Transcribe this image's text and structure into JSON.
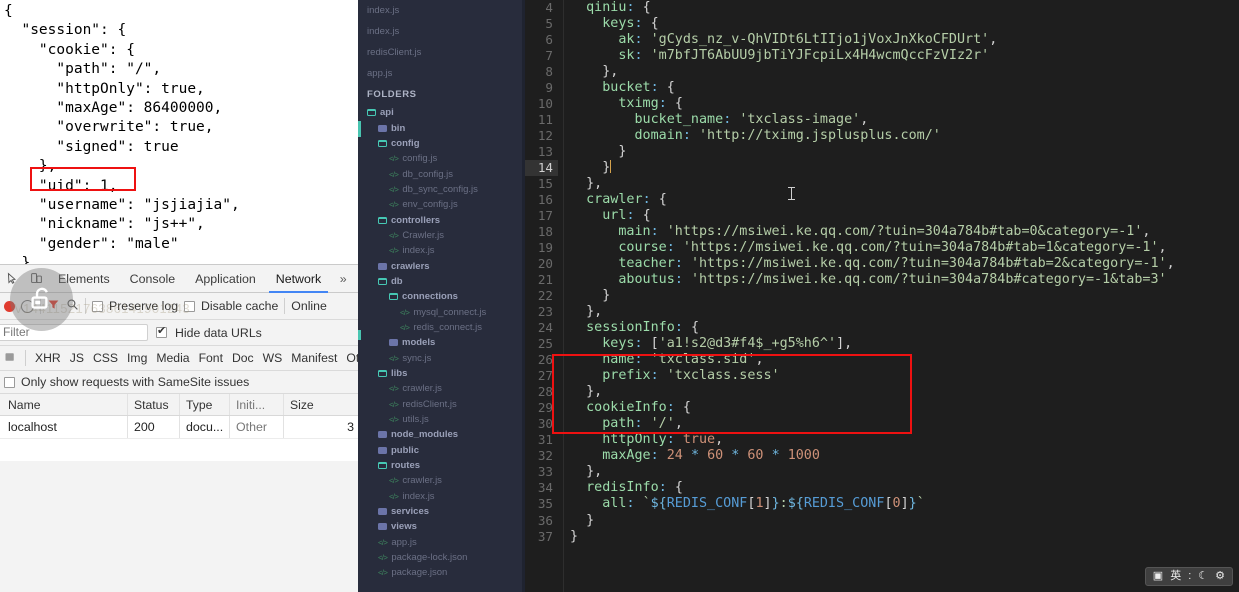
{
  "browser": {
    "json_response": [
      "{",
      "  \"session\": {",
      "    \"cookie\": {",
      "      \"path\": \"/\",",
      "      \"httpOnly\": true,",
      "      \"maxAge\": 86400000,",
      "      \"overwrite\": true,",
      "      \"signed\": true",
      "    },",
      "    \"uid\": 1,",
      "    \"username\": \"jsjiajia\",",
      "    \"nickname\": \"js++\",",
      "    \"gender\": \"male\"",
      "  }"
    ],
    "highlight_note": "uid-highlight"
  },
  "devtools": {
    "tabs": [
      {
        "label": "Elements",
        "active": false
      },
      {
        "label": "Console",
        "active": false
      },
      {
        "label": "Application",
        "active": false
      },
      {
        "label": "Network",
        "active": true
      }
    ],
    "toolbar": {
      "preserve_log_label": "Preserve log",
      "preserve_log_checked": false,
      "disable_cache_label": "Disable cache",
      "disable_cache_checked": false,
      "online_label": "Online"
    },
    "filter": {
      "placeholder": "Filter",
      "value": "",
      "hide_data_urls_label": "Hide data URLs",
      "hide_data_urls_checked": true
    },
    "types": [
      "XHR",
      "JS",
      "CSS",
      "Img",
      "Media",
      "Font",
      "Doc",
      "WS",
      "Manifest",
      "Other"
    ],
    "samesite": {
      "label": "Only show requests with SameSite issues",
      "checked": false
    },
    "table": {
      "columns": [
        "Name",
        "Status",
        "Type",
        "Initi...",
        "Size"
      ],
      "rows": [
        {
          "name": "localhost",
          "status": "200",
          "type": "docu...",
          "initiator": "Other",
          "size": "3"
        }
      ]
    },
    "watermark_text": "V1441152176386141901243"
  },
  "sidebar": {
    "open_files": [
      "index.js",
      "index.js",
      "redisClient.js",
      "app.js"
    ],
    "folders_label": "FOLDERS",
    "tree": [
      {
        "label": "api",
        "icon": "folder-open",
        "indent": 0
      },
      {
        "label": "bin",
        "icon": "folder-solid",
        "indent": 1
      },
      {
        "label": "config",
        "icon": "folder-open",
        "indent": 1
      },
      {
        "label": "config.js",
        "icon": "file",
        "indent": 2
      },
      {
        "label": "db_config.js",
        "icon": "file",
        "indent": 2
      },
      {
        "label": "db_sync_config.js",
        "icon": "file",
        "indent": 2
      },
      {
        "label": "env_config.js",
        "icon": "file",
        "indent": 2
      },
      {
        "label": "controllers",
        "icon": "folder-open",
        "indent": 1
      },
      {
        "label": "Crawler.js",
        "icon": "file",
        "indent": 2
      },
      {
        "label": "index.js",
        "icon": "file",
        "indent": 2
      },
      {
        "label": "crawlers",
        "icon": "folder-solid",
        "indent": 1
      },
      {
        "label": "db",
        "icon": "folder-open",
        "indent": 1
      },
      {
        "label": "connections",
        "icon": "folder-open",
        "indent": 2
      },
      {
        "label": "mysql_connect.js",
        "icon": "file",
        "indent": 3
      },
      {
        "label": "redis_connect.js",
        "icon": "file",
        "indent": 3
      },
      {
        "label": "models",
        "icon": "folder-solid",
        "indent": 2
      },
      {
        "label": "sync.js",
        "icon": "file",
        "indent": 2
      },
      {
        "label": "libs",
        "icon": "folder-open",
        "indent": 1
      },
      {
        "label": "crawler.js",
        "icon": "file",
        "indent": 2
      },
      {
        "label": "redisClient.js",
        "icon": "file",
        "indent": 2
      },
      {
        "label": "utils.js",
        "icon": "file",
        "indent": 2
      },
      {
        "label": "node_modules",
        "icon": "folder-solid",
        "indent": 1
      },
      {
        "label": "public",
        "icon": "folder-solid",
        "indent": 1
      },
      {
        "label": "routes",
        "icon": "folder-open",
        "indent": 1
      },
      {
        "label": "crawler.js",
        "icon": "file",
        "indent": 2
      },
      {
        "label": "index.js",
        "icon": "file",
        "indent": 2
      },
      {
        "label": "services",
        "icon": "folder-solid",
        "indent": 1
      },
      {
        "label": "views",
        "icon": "folder-solid",
        "indent": 1
      },
      {
        "label": "app.js",
        "icon": "file",
        "indent": 1
      },
      {
        "label": "package-lock.json",
        "icon": "file",
        "indent": 1
      },
      {
        "label": "package.json",
        "icon": "file",
        "indent": 1
      }
    ]
  },
  "editor": {
    "first_line_number": 4,
    "current_line": 14,
    "lines": [
      {
        "n": 4,
        "html": "  <span class='k'>qiniu</span><span class='p'>:</span> <span class='w'>{</span>"
      },
      {
        "n": 5,
        "html": "    <span class='k'>keys</span><span class='p'>:</span> <span class='w'>{</span>"
      },
      {
        "n": 6,
        "html": "      <span class='k'>ak</span><span class='p'>:</span> <span class='s'>'gCyds_nz_v-QhVIDt6LtIIjo1jVoxJnXkoCFDUrt'</span><span class='w'>,</span>"
      },
      {
        "n": 7,
        "html": "      <span class='k'>sk</span><span class='p'>:</span> <span class='s'>'m7bfJT6AbUU9jbTiYJFcpiLx4H4wcmQccFzVIz2r'</span>"
      },
      {
        "n": 8,
        "html": "    <span class='w'>},</span>"
      },
      {
        "n": 9,
        "html": "    <span class='k'>bucket</span><span class='p'>:</span> <span class='w'>{</span>"
      },
      {
        "n": 10,
        "html": "      <span class='k'>tximg</span><span class='p'>:</span> <span class='w'>{</span>"
      },
      {
        "n": 11,
        "html": "        <span class='k'>bucket_name</span><span class='p'>:</span> <span class='s'>'txclass-image'</span><span class='w'>,</span>"
      },
      {
        "n": 12,
        "html": "        <span class='k'>domain</span><span class='p'>:</span> <span class='s'>'http://tximg.jsplusplus.com/'</span>"
      },
      {
        "n": 13,
        "html": "      <span class='w'>}</span>"
      },
      {
        "n": 14,
        "html": "    <span class='w'>}</span><span class='caret'></span>"
      },
      {
        "n": 15,
        "html": "  <span class='w'>},</span>"
      },
      {
        "n": 16,
        "html": "  <span class='k'>crawler</span><span class='p'>:</span> <span class='w'>{</span>"
      },
      {
        "n": 17,
        "html": "    <span class='k'>url</span><span class='p'>:</span> <span class='w'>{</span>"
      },
      {
        "n": 18,
        "html": "      <span class='k'>main</span><span class='p'>:</span> <span class='s'>'https://msiwei.ke.qq.com/?tuin=304a784b#tab=0&amp;category=-1'</span><span class='w'>,</span>"
      },
      {
        "n": 19,
        "html": "      <span class='k'>course</span><span class='p'>:</span> <span class='s'>'https://msiwei.ke.qq.com/?tuin=304a784b#tab=1&amp;category=-1'</span><span class='w'>,</span>"
      },
      {
        "n": 20,
        "html": "      <span class='k'>teacher</span><span class='p'>:</span> <span class='s'>'https://msiwei.ke.qq.com/?tuin=304a784b#tab=2&amp;category=-1'</span><span class='w'>,</span>"
      },
      {
        "n": 21,
        "html": "      <span class='k'>aboutus</span><span class='p'>:</span> <span class='s'>'https://msiwei.ke.qq.com/?tuin=304a784b#category=-1&amp;tab=3'</span>"
      },
      {
        "n": 22,
        "html": "    <span class='w'>}</span>"
      },
      {
        "n": 23,
        "html": "  <span class='w'>},</span>"
      },
      {
        "n": 24,
        "html": "  <span class='k'>sessionInfo</span><span class='p'>:</span> <span class='w'>{</span>"
      },
      {
        "n": 25,
        "html": "    <span class='k'>keys</span><span class='p'>:</span> <span class='w'>[</span><span class='s'>'a1!s2@d3#f4$_+g5%h6^'</span><span class='w'>],</span>"
      },
      {
        "n": 26,
        "html": "    <span class='k'>name</span><span class='p'>:</span> <span class='s'>'txclass.sid'</span><span class='w'>,</span>"
      },
      {
        "n": 27,
        "html": "    <span class='k'>prefix</span><span class='p'>:</span> <span class='s'>'txclass.sess'</span>"
      },
      {
        "n": 28,
        "html": "  <span class='w'>},</span>"
      },
      {
        "n": 29,
        "html": "  <span class='k'>cookieInfo</span><span class='p'>:</span> <span class='w'>{</span>"
      },
      {
        "n": 30,
        "html": "    <span class='k'>path</span><span class='p'>:</span> <span class='s'>'/'</span><span class='w'>,</span>"
      },
      {
        "n": 31,
        "html": "    <span class='k'>httpOnly</span><span class='p'>:</span> <span class='n'>true</span><span class='w'>,</span>"
      },
      {
        "n": 32,
        "html": "    <span class='k'>maxAge</span><span class='p'>:</span> <span class='n'>24</span> <span class='op'>*</span> <span class='n'>60</span> <span class='op'>*</span> <span class='n'>60</span> <span class='op'>*</span> <span class='n'>1000</span>"
      },
      {
        "n": 33,
        "html": "  <span class='w'>},</span>"
      },
      {
        "n": 34,
        "html": "  <span class='k'>redisInfo</span><span class='p'>:</span> <span class='w'>{</span>"
      },
      {
        "n": 35,
        "html": "    <span class='k'>all</span><span class='p'>:</span> <span class='s'>`</span><span class='p'>${</span><span class='b'>REDIS_CONF</span><span class='w'>[</span><span class='n'>1</span><span class='w'>]</span><span class='p'>}</span><span class='s'>:</span><span class='p'>${</span><span class='b'>REDIS_CONF</span><span class='w'>[</span><span class='n'>0</span><span class='w'>]</span><span class='p'>}</span><span class='s'>`</span>"
      },
      {
        "n": 36,
        "html": "  <span class='w'>}</span>"
      },
      {
        "n": 37,
        "html": "<span class='w'>}</span>"
      }
    ],
    "highlight_note": "sessionInfo-highlight"
  },
  "ime": {
    "items": [
      "keyboard-icon",
      "chinese-mode-icon",
      "punctuation-icon",
      "moon-icon",
      "gear-icon"
    ],
    "glyphs": [
      "▣",
      "英",
      "ः",
      "☾",
      "✿"
    ]
  },
  "colors": {
    "editor_bg": "#1e1e1e",
    "sidebar_bg": "#282c3c",
    "accent_red": "#ee1111",
    "accent_blue": "#4285f4",
    "string_green": "#b5cea8"
  }
}
